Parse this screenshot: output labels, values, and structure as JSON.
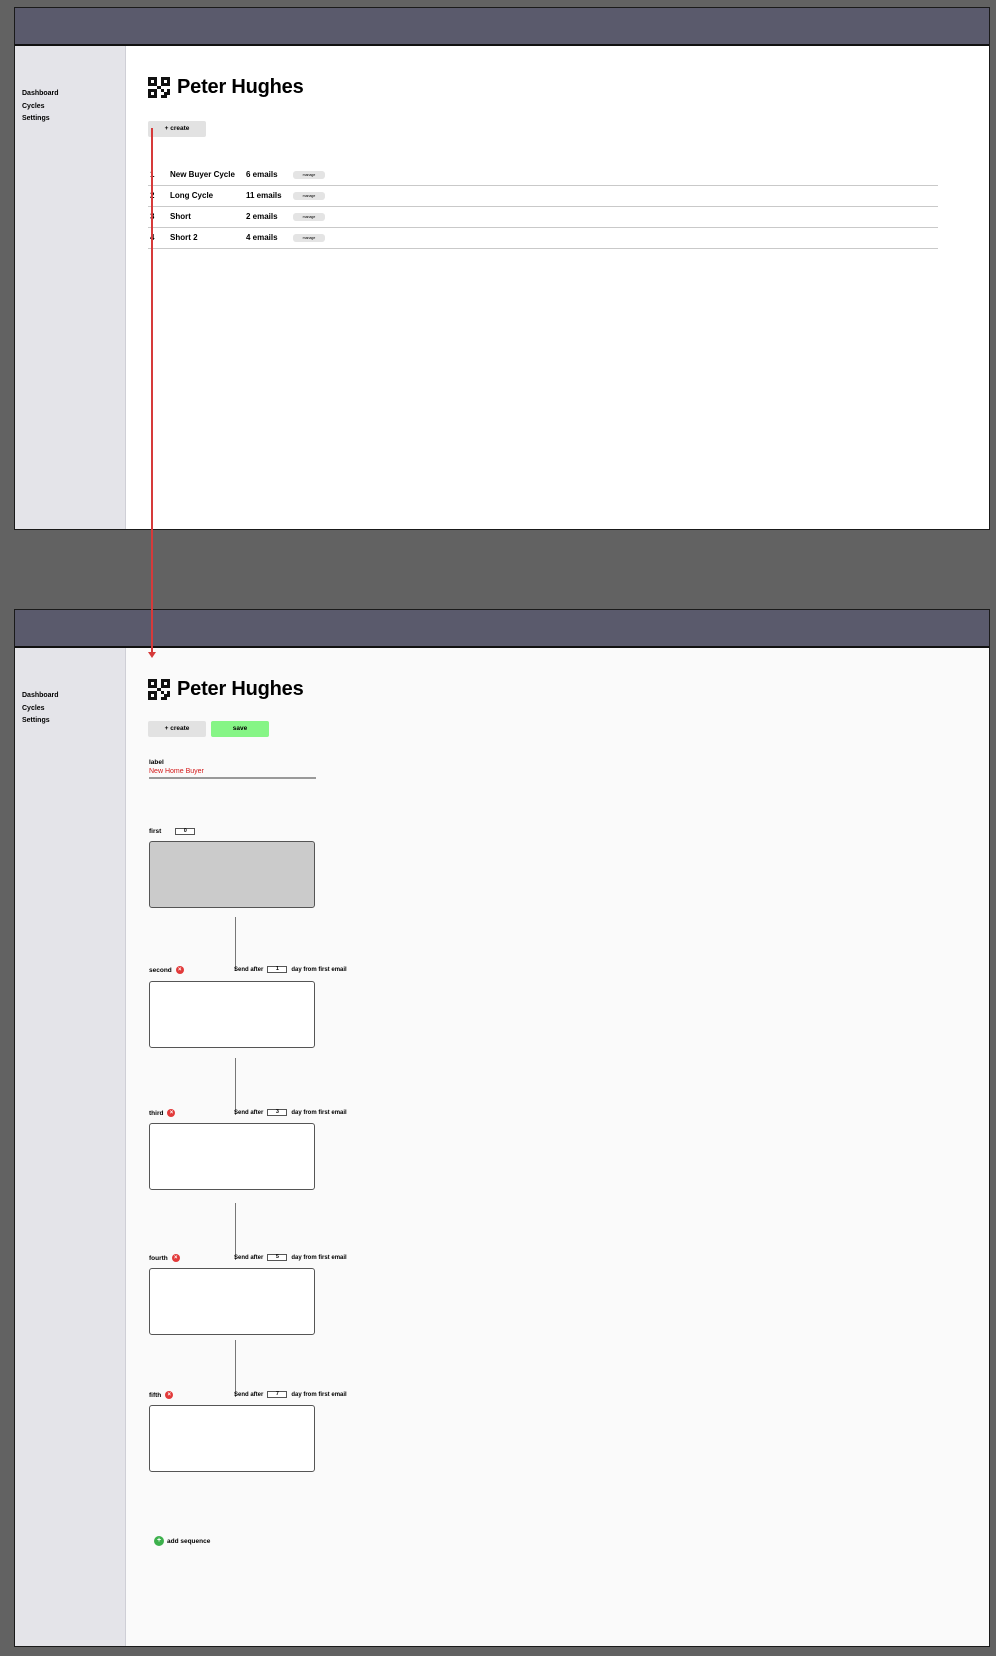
{
  "user": {
    "name": "Peter Hughes"
  },
  "sidebar": {
    "items": [
      {
        "label": "Dashboard"
      },
      {
        "label": "Cycles"
      },
      {
        "label": "Settings"
      }
    ]
  },
  "toolbar": {
    "create_label": "+ create",
    "save_label": "save"
  },
  "cycles_table": {
    "rows": [
      {
        "num": "1",
        "name": "New Buyer Cycle",
        "count": "6 emails",
        "manage_label": "manage"
      },
      {
        "num": "2",
        "name": "Long Cycle",
        "count": "11 emails",
        "manage_label": "manage"
      },
      {
        "num": "3",
        "name": "Short",
        "count": "2 emails",
        "manage_label": "manage"
      },
      {
        "num": "4",
        "name": "Short 2",
        "count": "4 emails",
        "manage_label": "manage"
      }
    ]
  },
  "form": {
    "label_title": "label",
    "label_value": "New Home Buyer",
    "send_after_prefix": "Send after",
    "send_after_suffix": "day from first email",
    "add_sequence_label": "add sequence",
    "sequences": [
      {
        "name": "first",
        "value": "0"
      },
      {
        "name": "second",
        "value": "1"
      },
      {
        "name": "third",
        "value": "3"
      },
      {
        "name": "fourth",
        "value": "5"
      },
      {
        "name": "fifth",
        "value": "7"
      }
    ]
  },
  "colors": {
    "topbar": "#5a5a6c",
    "sidebar": "#e4e4e9",
    "save": "#86f586",
    "delete": "#e23a3a",
    "add": "#3cb04c",
    "label_value": "#d31818",
    "arrow": "#d63a3a"
  },
  "icons": {
    "avatar": "qr-code-icon",
    "delete": "delete-icon",
    "add": "plus-icon"
  }
}
